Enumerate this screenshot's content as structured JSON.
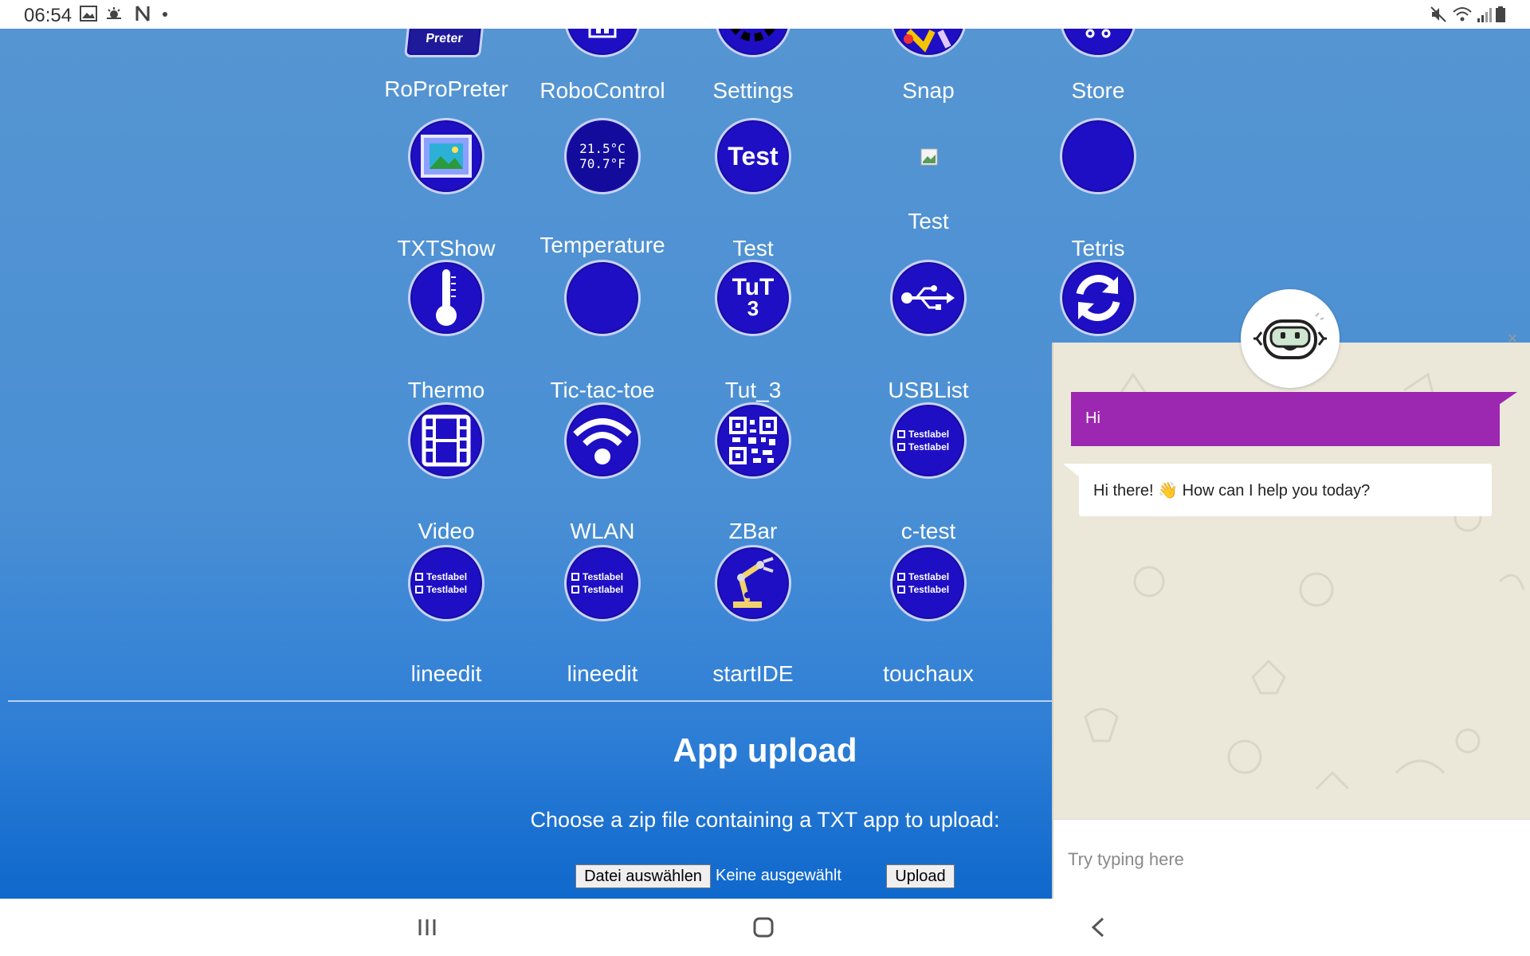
{
  "status_bar": {
    "time": "06:54"
  },
  "apps": [
    {
      "label": "RoProPreter",
      "icon": "roppreter-icon",
      "icon_text": "Preter"
    },
    {
      "label": "RoboControl",
      "icon": "robocontrol-icon"
    },
    {
      "label": "Settings",
      "icon": "settings-gear-icon"
    },
    {
      "label": "Snap",
      "icon": "snap-icon"
    },
    {
      "label": "Store",
      "icon": "store-icon"
    },
    {
      "label": "TXTShow",
      "icon": "picture-frame-icon"
    },
    {
      "label": "Temperature",
      "icon": "temperature-readout-icon",
      "icon_text_1": "21.5°C",
      "icon_text_2": "70.7°F"
    },
    {
      "label": "Test",
      "icon": "test-text-icon",
      "icon_text": "Test"
    },
    {
      "label": "Test",
      "icon": "broken-image-icon"
    },
    {
      "label": "Tetris",
      "icon": "blank-circle-icon"
    },
    {
      "label": "Thermo",
      "icon": "thermometer-icon"
    },
    {
      "label": "Tic-tac-toe",
      "icon": "blank-circle-icon"
    },
    {
      "label": "Tut_3",
      "icon": "tut3-icon",
      "icon_text_1": "TuT",
      "icon_text_2": "3"
    },
    {
      "label": "USBList",
      "icon": "usb-icon"
    },
    {
      "label": "",
      "icon": "refresh-icon"
    },
    {
      "label": "Video",
      "icon": "film-strip-icon"
    },
    {
      "label": "WLAN",
      "icon": "wifi-icon"
    },
    {
      "label": "ZBar",
      "icon": "qr-code-icon"
    },
    {
      "label": "c-test",
      "icon": "testlabel-icon",
      "icon_text": "Testlabel"
    },
    {
      "label": "lineedit",
      "icon": "testlabel-icon",
      "icon_text": "Testlabel"
    },
    {
      "label": "lineedit",
      "icon": "testlabel-icon",
      "icon_text": "Testlabel"
    },
    {
      "label": "startIDE",
      "icon": "robot-arm-icon"
    },
    {
      "label": "touchaux",
      "icon": "testlabel-icon",
      "icon_text": "Testlabel"
    }
  ],
  "upload": {
    "title": "App upload",
    "description": "Choose a zip file containing a TXT app to upload:",
    "choose_file_label": "Datei auswählen",
    "file_status": "Keine ausgewählt",
    "upload_label": "Upload"
  },
  "chat": {
    "close_icon": "×",
    "user_message": "Hi",
    "bot_message": "Hi there! 👋 How can I help you today?",
    "input_placeholder": "Try typing here"
  },
  "colors": {
    "icon_blue": "#1e0fc4",
    "chat_purple": "#9c27b0",
    "chat_bg": "#ebe8da"
  }
}
